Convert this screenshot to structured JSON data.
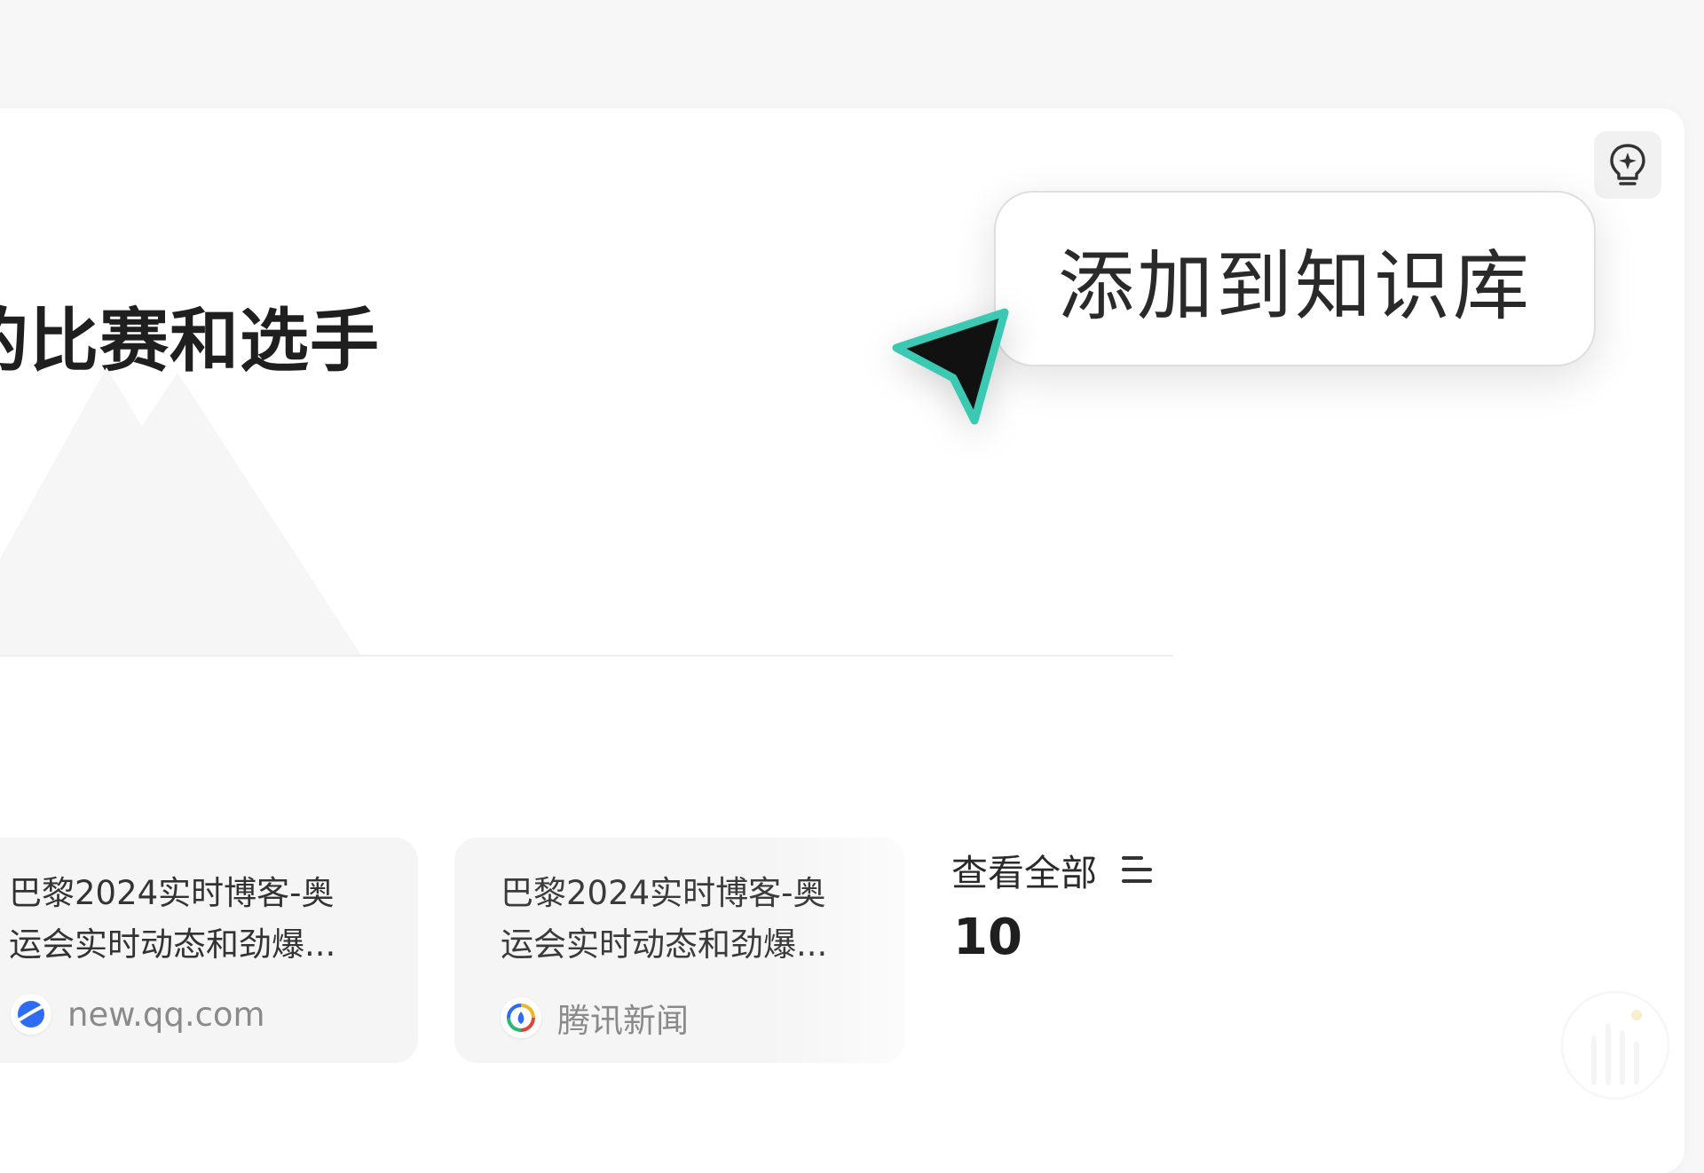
{
  "heading": "的比赛和选手",
  "tooltip": {
    "label": "添加到知识库"
  },
  "sources": [
    {
      "title_line1": "巴黎2024实时博客-奥",
      "title_line2": "运会实时动态和劲爆...",
      "site": "new.qq.com",
      "icon": "planet-icon"
    },
    {
      "title_line1": "巴黎2024实时博客-奥",
      "title_line2": "运会实时动态和劲爆...",
      "site": "腾讯新闻",
      "icon": "tencent-news-icon"
    }
  ],
  "view_all": {
    "label": "查看全部",
    "count": "10"
  },
  "colors": {
    "cursor_fill": "#111111",
    "cursor_outline": "#3cc9b3",
    "planet_blue": "#2f6cf5",
    "page_bg": "#f7f7f7"
  }
}
